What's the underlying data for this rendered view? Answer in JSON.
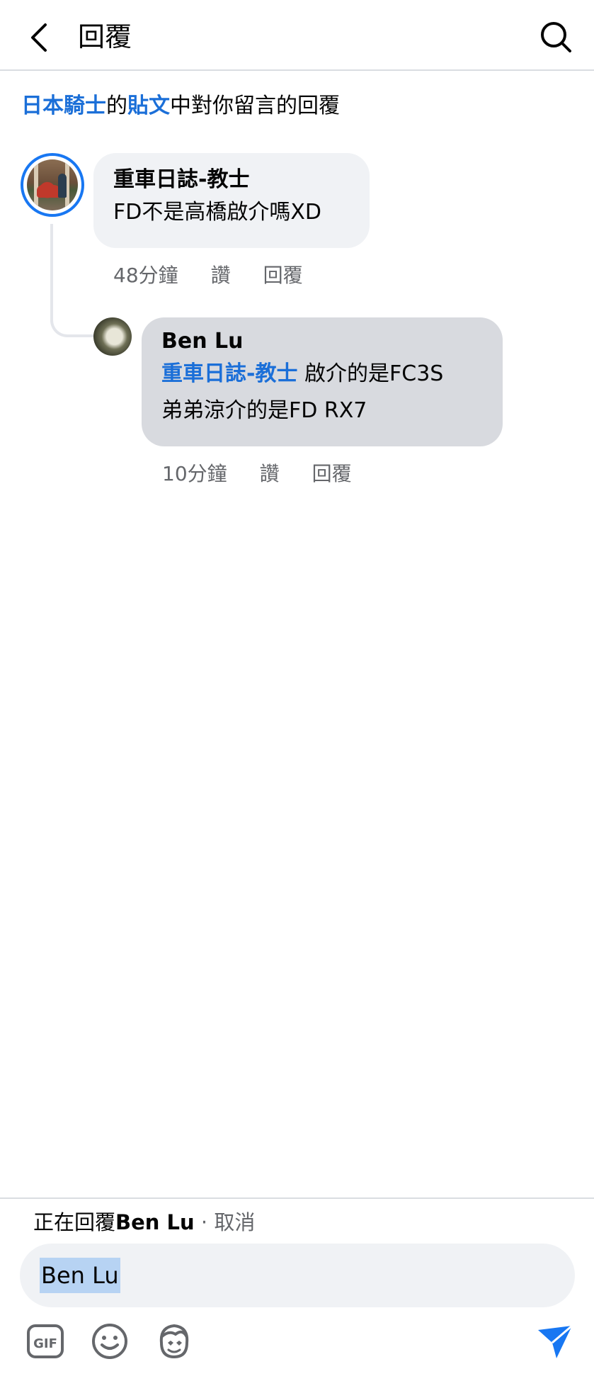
{
  "header": {
    "title": "回覆",
    "back_icon": "chevron-left-icon",
    "search_icon": "search-icon"
  },
  "context": {
    "page_link": "日本騎士",
    "connector": "的",
    "post_link": "貼文",
    "suffix": "中對你留言的回覆"
  },
  "comments": [
    {
      "author": "重車日誌-教士",
      "text": "FD不是高橋啟介嗎XD",
      "time": "48分鐘",
      "like_label": "讚",
      "reply_label": "回覆"
    },
    {
      "author": "Ben Lu",
      "mention": "重車日誌-教士",
      "text_line1": " 啟介的是FC3S",
      "text_line2": "弟弟涼介的是FD RX7",
      "time": "10分鐘",
      "like_label": "讚",
      "reply_label": "回覆"
    }
  ],
  "composer": {
    "replying_prefix": "正在回覆",
    "replying_name": "Ben Lu",
    "separator": " · ",
    "cancel_label": "取消",
    "input_value": "Ben Lu",
    "tools": [
      "gif-icon",
      "emoji-icon",
      "avatar-sticker-icon",
      "send-icon"
    ],
    "accent_color": "#1877f2"
  }
}
